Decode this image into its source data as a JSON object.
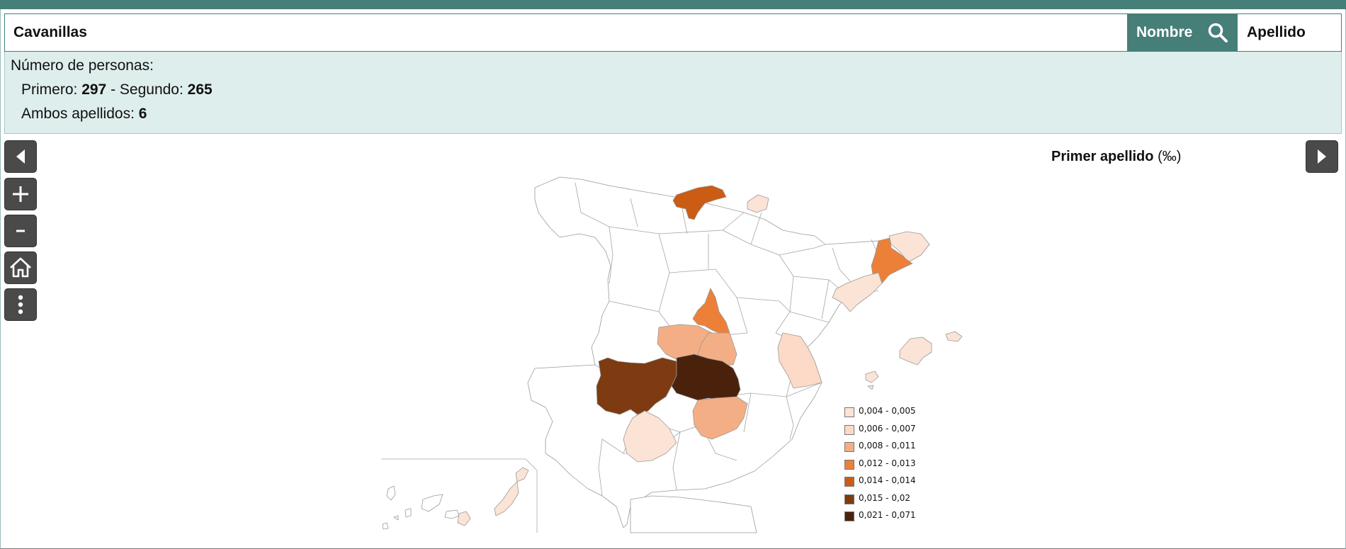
{
  "search": {
    "value": "Cavanillas"
  },
  "buttons": {
    "nombre": "Nombre",
    "apellido": "Apellido"
  },
  "info": {
    "heading": "Número de personas:",
    "primero_label": "Primero: ",
    "primero_value": "297",
    "sep": " - ",
    "segundo_label": "Segundo: ",
    "segundo_value": "265",
    "ambos_label": "Ambos apellidos: ",
    "ambos_value": "6"
  },
  "map": {
    "title": "Primer apellido",
    "unit": "(‰)",
    "legend": [
      {
        "label": "0,004 - 0,005",
        "color": "#fbe3d6"
      },
      {
        "label": "0,006 - 0,007",
        "color": "#fcdac7"
      },
      {
        "label": "0,008 - 0,011",
        "color": "#f4ae85"
      },
      {
        "label": "0,012 - 0,013",
        "color": "#ec8038"
      },
      {
        "label": "0,014 - 0,014",
        "color": "#ca5c13"
      },
      {
        "label": "0,015 - 0,02",
        "color": "#7e3a10"
      },
      {
        "label": "0,021 - 0,071",
        "color": "#4a220c"
      }
    ],
    "highlighted_regions": [
      {
        "name": "Cantabria",
        "class": 5
      },
      {
        "name": "Álava",
        "class": 1
      },
      {
        "name": "Girona",
        "class": 1
      },
      {
        "name": "Barcelona",
        "class": 4
      },
      {
        "name": "Castellón",
        "class": 1
      },
      {
        "name": "Madrid",
        "class": 4
      },
      {
        "name": "Toledo",
        "class": 3
      },
      {
        "name": "Cuenca",
        "class": 3
      },
      {
        "name": "Valencia",
        "class": 1
      },
      {
        "name": "Cáceres",
        "class": 6
      },
      {
        "name": "Ciudad Real",
        "class": 7
      },
      {
        "name": "Jaén",
        "class": 3
      },
      {
        "name": "Sevilla",
        "class": 1
      },
      {
        "name": "Mallorca",
        "class": 1
      },
      {
        "name": "Gran Canaria",
        "class": 1
      },
      {
        "name": "Fuerteventura",
        "class": 1
      }
    ]
  }
}
